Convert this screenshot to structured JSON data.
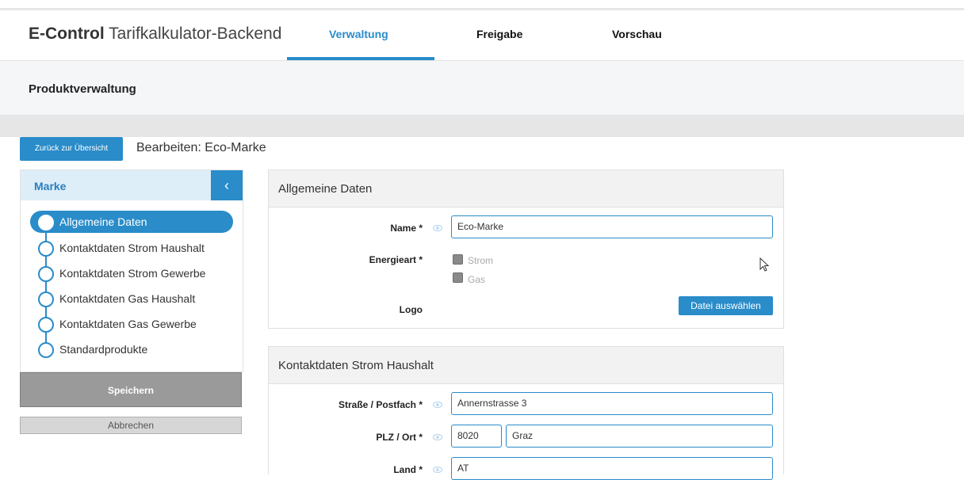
{
  "app": {
    "brand_bold": "E-Control",
    "brand_rest": "Tarifkalkulator-Backend"
  },
  "nav": {
    "tabs": [
      {
        "label": "Verwaltung",
        "active": true
      },
      {
        "label": "Freigabe"
      },
      {
        "label": "Vorschau"
      }
    ]
  },
  "page": {
    "title": "Produktverwaltung",
    "back_label": "Zurück zur Übersicht",
    "edit_title": "Bearbeiten: Eco-Marke"
  },
  "sidebar": {
    "header": "Marke",
    "collapse_icon": "‹",
    "items": [
      {
        "label": "Allgemeine Daten",
        "active": true
      },
      {
        "label": "Kontaktdaten Strom Haushalt"
      },
      {
        "label": "Kontaktdaten Strom Gewerbe"
      },
      {
        "label": "Kontaktdaten Gas Haushalt"
      },
      {
        "label": "Kontaktdaten Gas Gewerbe"
      },
      {
        "label": "Standardprodukte"
      }
    ],
    "save_label": "Speichern",
    "cancel_label": "Abbrechen"
  },
  "general": {
    "title": "Allgemeine Daten",
    "name_label": "Name *",
    "name_value": "Eco-Marke",
    "energy_label": "Energieart *",
    "energy_options": [
      "Strom",
      "Gas"
    ],
    "logo_label": "Logo",
    "file_button": "Datei auswählen"
  },
  "contact": {
    "title": "Kontaktdaten Strom Haushalt",
    "street_label": "Straße / Postfach *",
    "street_value": "Annernstrasse 3",
    "plz_label": "PLZ / Ort *",
    "plz_value": "8020",
    "city_value": "Graz",
    "country_label": "Land *",
    "country_value": "AT"
  },
  "colors": {
    "accent": "#2a8cc9",
    "sidebar_head_bg": "#ddeef9",
    "save_bg": "#9a9a9a"
  }
}
